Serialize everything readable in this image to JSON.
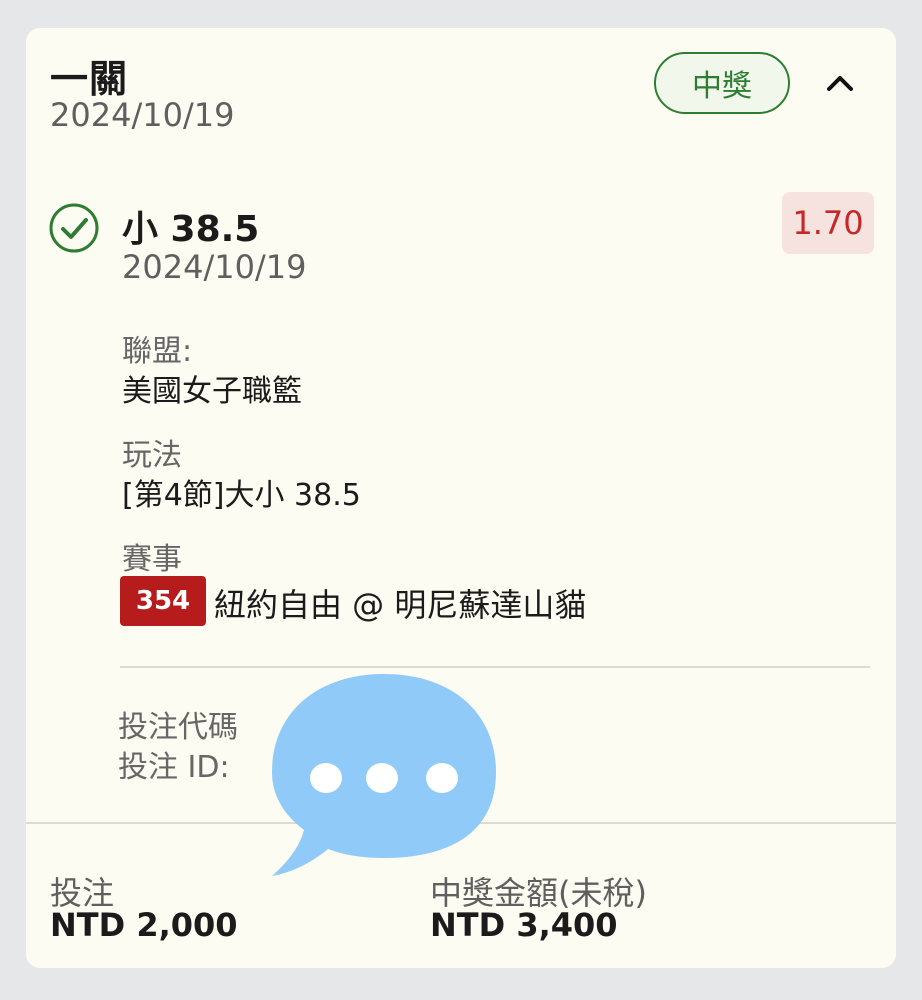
{
  "bet": {
    "type": "一關",
    "date": "2024/10/19",
    "status": "中獎"
  },
  "selection": {
    "title": "小 38.5",
    "date": "2024/10/19",
    "odds": "1.70",
    "league_label": "聯盟:",
    "league_value": "美國女子職籃",
    "market_label": "玩法",
    "market_value": "[第4節]大小 38.5",
    "event_label": "賽事",
    "event_number": "354",
    "event_name": "紐約自由 @ 明尼蘇達山貓"
  },
  "codes": {
    "code_label": "投注代碼",
    "id_label": "投注 ID:"
  },
  "footer": {
    "stake_label": "投注",
    "stake_value": "NTD 2,000",
    "win_label": "中獎金額(未稅)",
    "win_value": "NTD 3,400"
  },
  "colors": {
    "won": "#2e7d32",
    "odds": "#c62828",
    "event_badge": "#b71c1c",
    "overlay_bubble": "#90caf9"
  }
}
